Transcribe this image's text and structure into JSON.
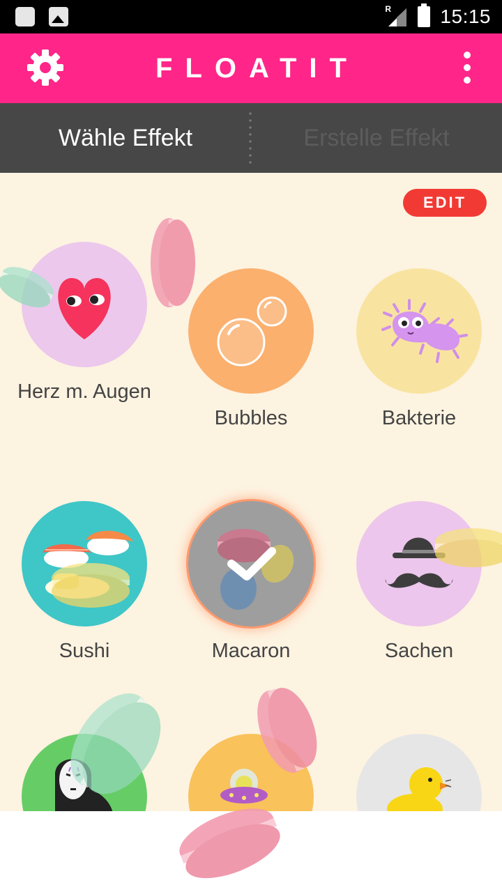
{
  "status_bar": {
    "time": "15:15",
    "network_badge": "R"
  },
  "app_bar": {
    "title": "FLOATIT"
  },
  "tabs": [
    {
      "label": "Wähle Effekt",
      "active": true
    },
    {
      "label": "Erstelle Effekt",
      "active": false
    }
  ],
  "edit_label": "EDIT",
  "effects": [
    {
      "label": "Herz m. Augen",
      "icon": "heart-with-eyes-icon",
      "bg": "#ecc8ec"
    },
    {
      "label": "Bubbles",
      "icon": "bubbles-icon",
      "bg": "#fbb06e"
    },
    {
      "label": "Bakterie",
      "icon": "bacteria-icon",
      "bg": "#f8e4a0"
    },
    {
      "label": "Sushi",
      "icon": "sushi-icon",
      "bg": "#3fc6c7"
    },
    {
      "label": "Macaron",
      "icon": "macaron-icon",
      "bg": "#9e9e9e",
      "selected": true
    },
    {
      "label": "Sachen",
      "icon": "hat-mustache-icon",
      "bg": "#ecc6ec"
    },
    {
      "label": "",
      "icon": "no-face-icon",
      "bg": "#66cd66"
    },
    {
      "label": "",
      "icon": "ufo-icon",
      "bg": "#f9c25b"
    },
    {
      "label": "",
      "icon": "duck-icon",
      "bg": "#e6e6e6"
    }
  ],
  "colors": {
    "accent": "#ff2589",
    "tab_bg": "#474747",
    "edit": "#f23a34",
    "page_bg": "#fdf3e1"
  }
}
